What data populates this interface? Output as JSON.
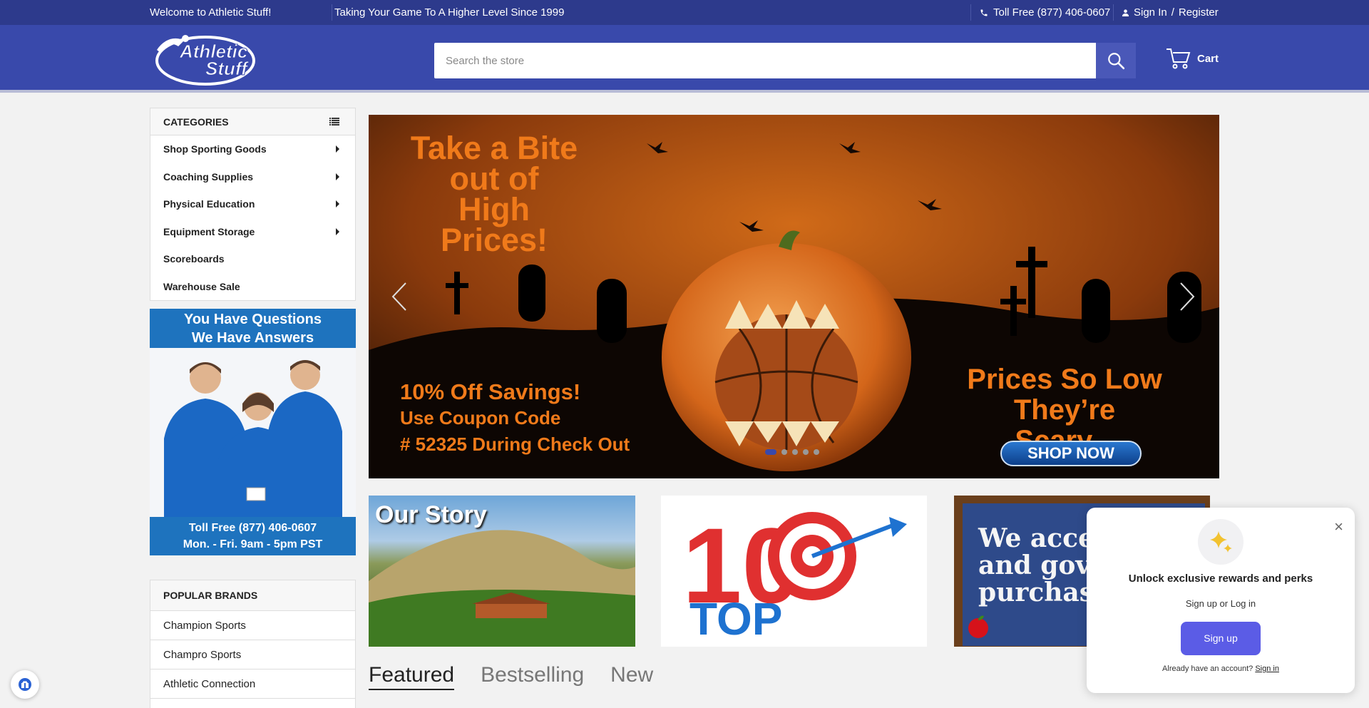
{
  "topbar": {
    "welcome": "Welcome to Athletic Stuff!",
    "tagline": "Taking Your Game To A Higher Level Since 1999",
    "phone": "Toll Free (877) 406-0607",
    "sign_in": "Sign In",
    "divider": "/",
    "register": "Register"
  },
  "header": {
    "logo_text_1": "Athletic",
    "logo_text_2": "Stuff",
    "search_placeholder": "Search the store",
    "cart_label": "Cart"
  },
  "categories": {
    "heading": "CATEGORIES",
    "items": [
      {
        "label": "Shop Sporting Goods",
        "has_submenu": true
      },
      {
        "label": "Coaching Supplies",
        "has_submenu": true
      },
      {
        "label": "Physical Education",
        "has_submenu": true
      },
      {
        "label": "Equipment Storage",
        "has_submenu": true
      },
      {
        "label": "Scoreboards",
        "has_submenu": false
      },
      {
        "label": "Warehouse Sale",
        "has_submenu": false
      }
    ]
  },
  "support_banner": {
    "line1": "You Have Questions",
    "line2": "We Have Answers",
    "phone": "Toll Free (877) 406-0607",
    "hours": "Mon. - Fri.  9am - 5pm PST"
  },
  "brands": {
    "heading": "POPULAR BRANDS",
    "items": [
      "Champion Sports",
      "Champro Sports",
      "Athletic Connection"
    ]
  },
  "hero": {
    "title_1": "Take a Bite",
    "title_2": "out of",
    "title_3": "High Prices!",
    "offer_1": "10% Off Savings!",
    "offer_2": "Use Coupon Code",
    "offer_3": "#  52325 During Check Out",
    "scary_1": "Prices So Low",
    "scary_2": "They’re Scary...",
    "cta": "SHOP NOW",
    "slide_count": 5,
    "active_slide": 1
  },
  "tiles": {
    "our_story": "Our Story",
    "top_text": "TOP",
    "top_number": "10",
    "chalk_1": "We accep",
    "chalk_2": "and gove",
    "chalk_3": "purchase"
  },
  "tabs": [
    {
      "label": "Featured",
      "active": true
    },
    {
      "label": "Bestselling",
      "active": false
    },
    {
      "label": "New",
      "active": false
    }
  ],
  "popup": {
    "title": "Unlock exclusive rewards and perks",
    "subtitle": "Sign up or Log in",
    "signup_label": "Sign up",
    "already_text": "Already have an account?",
    "signin_link": "Sign in",
    "close_glyph": "×"
  },
  "colors": {
    "topbar_bg": "#2d3a8c",
    "header_bg": "#3949ab",
    "hero_orange": "#f07a1a",
    "popup_button": "#5b5ce6"
  }
}
